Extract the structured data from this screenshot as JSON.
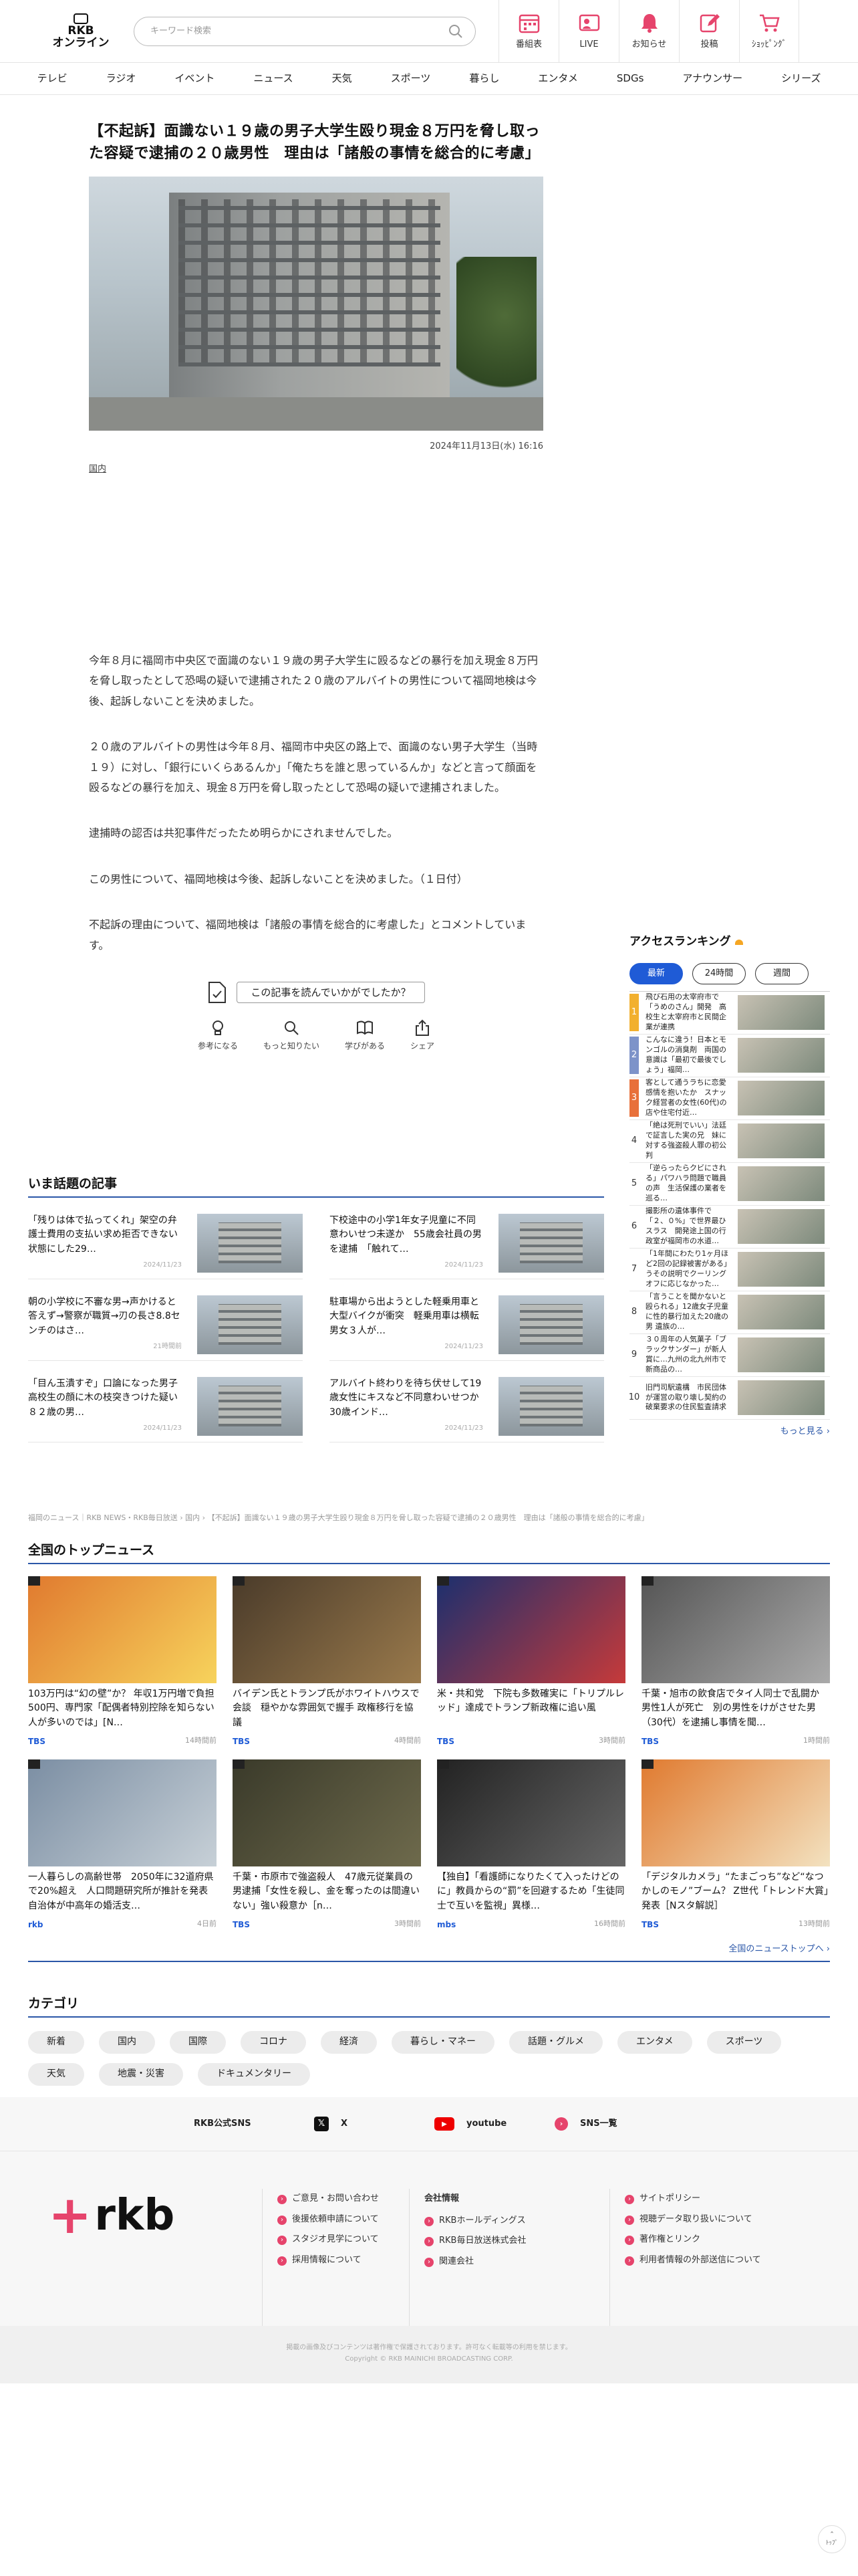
{
  "header": {
    "logo_line1": "RKB",
    "logo_line2": "オンライン",
    "search_placeholder": "キーワード検索",
    "icons": [
      {
        "label": "番組表",
        "icon": "calendar-icon"
      },
      {
        "label": "LIVE",
        "icon": "live-icon"
      },
      {
        "label": "お知らせ",
        "icon": "bell-icon"
      },
      {
        "label": "投稿",
        "icon": "post-icon"
      },
      {
        "label": "ｼｮｯﾋﾟﾝｸﾞ",
        "icon": "cart-icon"
      }
    ]
  },
  "nav": [
    "テレビ",
    "ラジオ",
    "イベント",
    "ニュース",
    "天気",
    "スポーツ",
    "暮らし",
    "エンタメ",
    "SDGs",
    "アナウンサー",
    "シリーズ"
  ],
  "article": {
    "title": "【不起訴】面識ない１９歳の男子大学生殴り現金８万円を脅し取った容疑で逮捕の２０歳男性　理由は「諸般の事情を総合的に考慮」",
    "date": "2024年11月13日(水) 16:16",
    "category": "国内",
    "paragraphs": [
      "今年８月に福岡市中央区で面識のない１９歳の男子大学生に殴るなどの暴行を加え現金８万円を脅し取ったとして恐喝の疑いで逮捕された２０歳のアルバイトの男性について福岡地検は今後、起訴しないことを決めました。",
      "２０歳のアルバイトの男性は今年８月、福岡市中央区の路上で、面識のない男子大学生（当時１９）に対し、「銀行にいくらあるんか」「俺たちを誰と思っているんか」などと言って顔面を殴るなどの暴行を加え、現金８万円を脅し取ったとして恐喝の疑いで逮捕されました。",
      "逮捕時の認否は共犯事件だったため明らかにされませんでした。",
      "この男性について、福岡地検は今後、起訴しないことを決めました。（１日付）",
      "不起訴の理由について、福岡地検は「諸般の事情を総合的に考慮した」とコメントしています。"
    ],
    "feedback": "この記事を読んでいかがでしたか？",
    "reactions": [
      {
        "label": "参考になる",
        "icon": "bulb-icon"
      },
      {
        "label": "もっと知りたい",
        "icon": "magnifier-icon"
      },
      {
        "label": "学びがある",
        "icon": "book-icon"
      },
      {
        "label": "シェア",
        "icon": "share-icon"
      }
    ]
  },
  "trending": {
    "heading": "いま話題の記事",
    "items": [
      {
        "title": "「残りは体で払ってくれ」架空の弁護士費用の支払い求め拒否できない状態にした29…",
        "date": "2024/11/23"
      },
      {
        "title": "下校途中の小学1年女子児童に不同意わいせつ未遂か　55歳会社員の男を逮捕　「触れて…",
        "date": "2024/11/23"
      },
      {
        "title": "朝の小学校に不審な男→声かけると答えず→警察が職質→刃の長さ8.8センチのはさ…",
        "date": "21時間前"
      },
      {
        "title": "駐車場から出ようとした軽乗用車と大型バイクが衝突　軽乗用車は横転　男女３人が…",
        "date": "2024/11/23"
      },
      {
        "title": "「目ん玉潰すぞ」口論になった男子高校生の顔に木の枝突きつけた疑い　８２歳の男…",
        "date": "2024/11/23"
      },
      {
        "title": "アルバイト終わりを待ち伏せして19歳女性にキスなど不同意わいせつか　30歳インド…",
        "date": "2024/11/23"
      }
    ]
  },
  "ranking": {
    "heading": "アクセスランキング",
    "tabs": [
      "最新",
      "24時間",
      "週間"
    ],
    "items": [
      {
        "no": "1",
        "title": "飛び石用の太宰府市で「うめのさん」開発　高校生と太宰府市と民間企業が連携",
        "color": "#f2b02e"
      },
      {
        "no": "2",
        "title": "こんなに違う！日本とモンゴルの消臭剤　両国の意識は「最初で最後でしょう」福岡…",
        "color": "#7d93c9"
      },
      {
        "no": "3",
        "title": "客として通うラちに恋愛感情を抱いたか　スナック経営者の女性(60代)の店や住宅付近…",
        "color": "#e8703a"
      },
      {
        "no": "4",
        "title": "「絶は死刑でいい」法廷で証言した実の兄　妹に対する強盗殺人罪の初公判",
        "color": ""
      },
      {
        "no": "5",
        "title": "「逆らったらクビにされる」パワハラ問題で職員の声　生活保護の業者を巡る…",
        "color": ""
      },
      {
        "no": "6",
        "title": "撮影所の遺体事件で「２、０%」で世界最ひスラス　開発途上国の行政室が福岡市の水道…",
        "color": ""
      },
      {
        "no": "7",
        "title": "「1年間にわたり1ヶ月ほど2回の記録被害がある」うその説明でクーリングオフに応じなかった…",
        "color": ""
      },
      {
        "no": "8",
        "title": "「言うことを聞かないと殴られる」12歳女子児童に性的暴行加えた20歳の男 遺族の…",
        "color": ""
      },
      {
        "no": "9",
        "title": "３０周年の人気菓子「ブラックサンダー」が新人賞に…九州の北九州市で新商品の…",
        "color": ""
      },
      {
        "no": "10",
        "title": "旧門司駅遺構　市民団体が運営の取り壊し契約の破棄要求の住民監査請求",
        "color": ""
      }
    ],
    "more": "もっと見る ›"
  },
  "breadcrumb": "福岡のニュース｜RKB NEWS・RKB毎日放送 › 国内 › 【不起訴】面識ない１９歳の男子大学生殴り現金８万円を脅し取った容疑で逮捕の２０歳男性　理由は「諸般の事情を総合的に考慮」",
  "national": {
    "heading": "全国のトップニュース",
    "items": [
      {
        "title": "103万円は“幻の壁”か？ 年収1万円増で負担500円、専門家「配偶者特別控除を知らない人が多いのでは」[N…",
        "source": "TBS",
        "time": "14時間前"
      },
      {
        "title": "バイデン氏とトランプ氏がホワイトハウスで会談　穏やかな雰囲気で握手 政権移行を協議",
        "source": "TBS",
        "time": "4時間前"
      },
      {
        "title": "米・共和党　下院も多数確実に「トリプルレッド」達成でトランプ新政権に追い風",
        "source": "TBS",
        "time": "3時間前"
      },
      {
        "title": "千葉・旭市の飲食店でタイ人同士で乱闘か　男性1人が死亡　別の男性をけがさせた男（30代）を逮捕し事情を聞…",
        "source": "TBS",
        "time": "1時間前"
      },
      {
        "title": "一人暮らしの高齢世帯　2050年に32道府県で20%超え　人口問題研究所が推計を発表　自治体が中高年の婚活支…",
        "source": "rkb",
        "time": "4日前"
      },
      {
        "title": "千葉・市原市で強盗殺人　47歳元従業員の男逮捕「女性を殺し、金を奪ったのは間違いない」強い殺意か［n…",
        "source": "TBS",
        "time": "3時間前"
      },
      {
        "title": "【独自】「看護師になりたくて入ったけどのに」教員からの“罰”を回避するため「生徒同士で互いを監視」異様…",
        "source": "mbs",
        "time": "16時間前"
      },
      {
        "title": "「デジタルカメラ」“たまごっち”など“なつかしのモノ”ブーム？ Z世代「トレンド大賞」発表［Nスタ解説］",
        "source": "TBS",
        "time": "13時間前"
      }
    ],
    "more": "全国のニューストップへ ›"
  },
  "categories": {
    "heading": "カテゴリ",
    "items": [
      "新着",
      "国内",
      "国際",
      "コロナ",
      "経済",
      "暮らし・マネー",
      "話題・グルメ",
      "エンタメ",
      "スポーツ",
      "天気",
      "地震・災害",
      "ドキュメンタリー"
    ]
  },
  "sns": {
    "label": "RKB公式SNS",
    "x": "X",
    "youtube": "youtube",
    "list": "SNS一覧"
  },
  "footer": {
    "logo": "rkb",
    "col1": [
      "ご意見・お問い合わせ",
      "後援依頼申請について",
      "スタジオ見学について",
      "採用情報について"
    ],
    "col2_title": "会社情報",
    "col2": [
      "RKBホールディングス",
      "RKB毎日放送株式会社",
      "関連会社"
    ],
    "col3": [
      "サイトポリシー",
      "視聴データ取り扱いについて",
      "著作権とリンク",
      "利用者情報の外部送信について"
    ],
    "copy1": "掲載の画像及びコンテンツは著作権で保護されております。許可なく転載等の利用を禁じます。",
    "copy2": "Copyright © RKB MAINICHI BROADCASTING CORP."
  },
  "top_label": "ﾄｯﾌﾟ"
}
